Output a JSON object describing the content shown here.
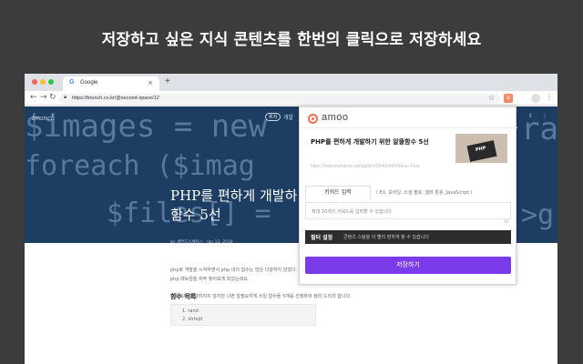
{
  "headline": "저장하고 싶은 지식 콘텐츠를 한번의 클릭으로 저장하세요",
  "browser": {
    "tab_title": "Google",
    "tab_icon": "G",
    "tab_close": "×",
    "new_tab": "+",
    "back": "←",
    "forward": "→",
    "reload": "↻",
    "url": "https://brunch.co.kr/@second-space/12",
    "menu": "⋮"
  },
  "page": {
    "brand": "brunch",
    "code_lines": [
      "$images = new",
      "foreach ($imag",
      "$files[] =",
      "ra",
      ">g"
    ],
    "category_badge": "위치",
    "nav_partial": "개발",
    "title_line1": "PHP를 편하게 개발하",
    "title_line2": "함수 5선",
    "meta": "by 세컨드스페이스 · Jan 13. 2018",
    "article_lines": [
      "php로 개발을 시작하면서 php 내의 함수는 많은 다양하지 않았다. php 함수 중에서",
      "php 매뉴얼을 자주 찾아보게 되었는데요.",
      "그중에서 잘 알려지지 않지만 나면 알필요하게 쓰일 함수들 5개를 선정하여 정리 드리려 합니다."
    ],
    "toc_heading": "함수 목록",
    "toc_items": [
      "1. rand",
      "2. strlejd"
    ]
  },
  "popup": {
    "logo_text": "amoo",
    "card_title": "PHP를 편하게 개발하기 위한 알뜰함수 5선",
    "thumb_text": "PHP",
    "card_url": "https://www.behance.net/gallery/55462490/Ideas-Free",
    "keyword_tab": "키워드 입력",
    "keyword_hint": "( EX. 모바일, 소셜 팔로, 웹에 활용, JavaScript )",
    "keyword_placeholder": "최대 10개의 키워드를 입력할 수 있습니다",
    "keyword_count": "10",
    "filter_label": "필터 설정",
    "filter_desc": "콘텐츠 스팀을 더 빨리 편하게 찾 수 있습니다",
    "save_label": "저장하기"
  },
  "colors": {
    "background": "#3c3c3c",
    "hero": "#1d3d63",
    "accent": "#7b3bea",
    "logo": "#ee6b4d"
  }
}
